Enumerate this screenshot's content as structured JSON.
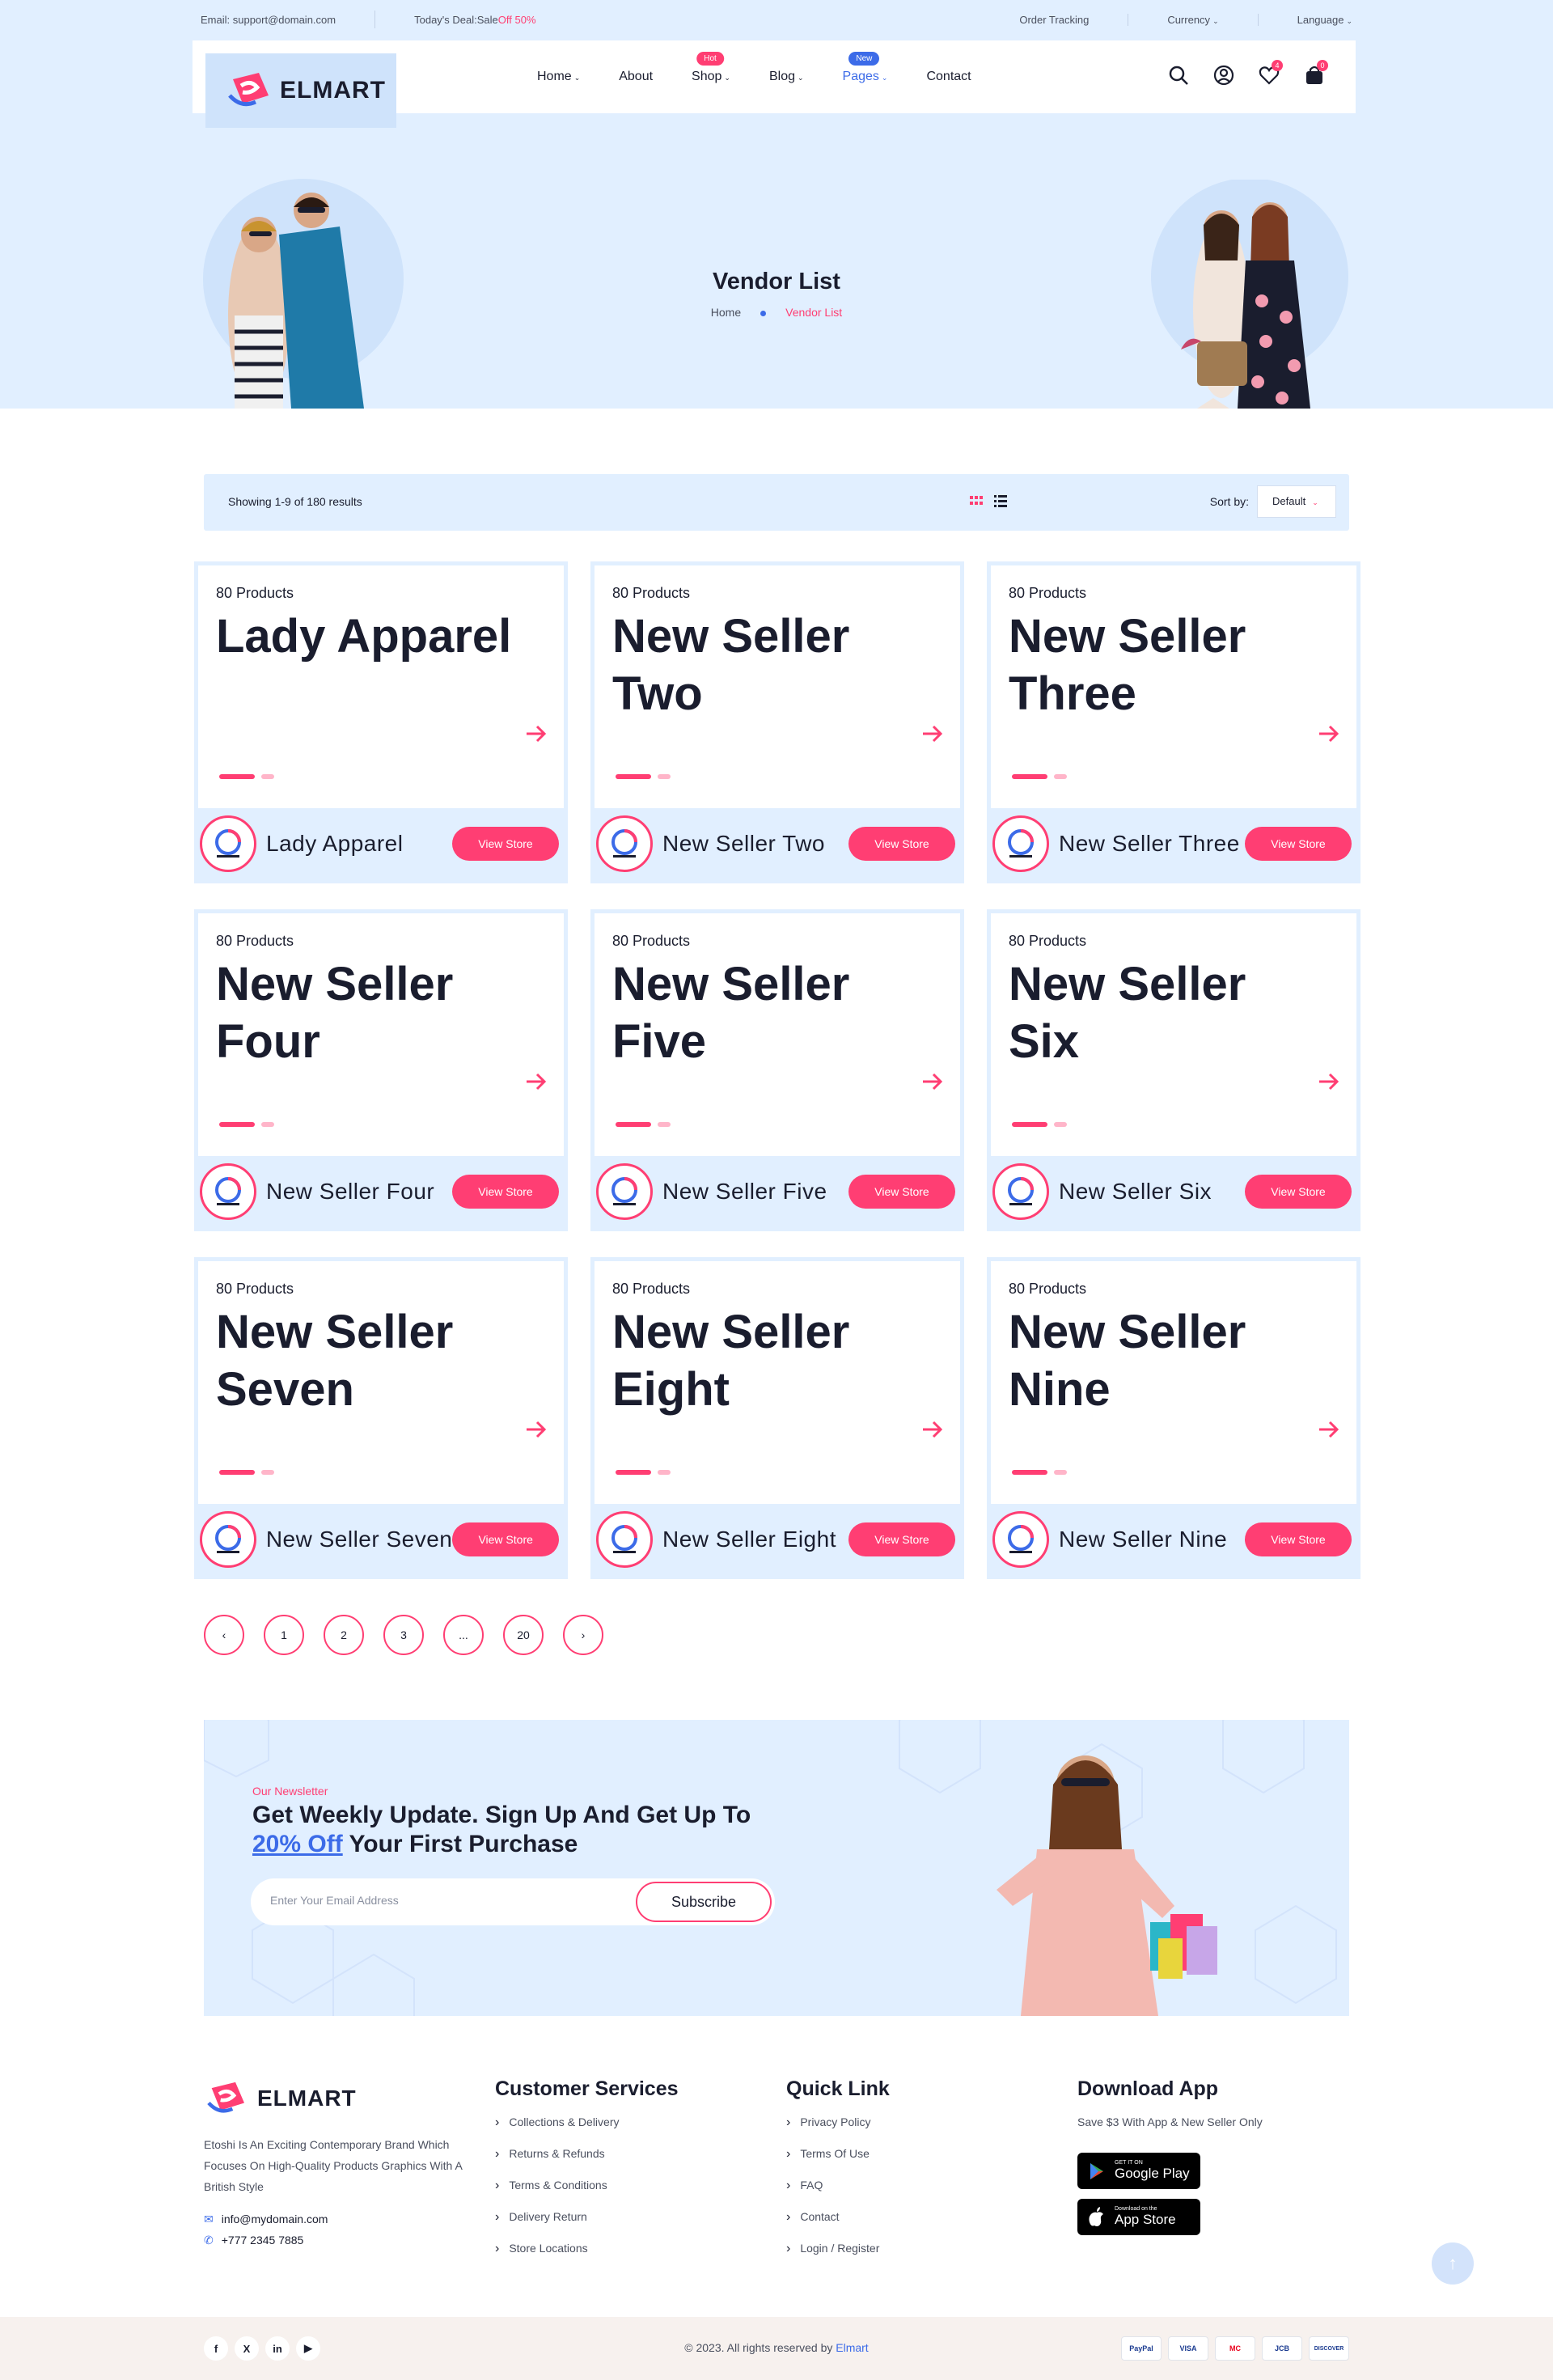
{
  "topbar": {
    "email": "Email: support@domain.com",
    "deal_label": "Today's Deal:Sale ",
    "deal_off": "Off 50%",
    "order_tracking": "Order Tracking",
    "currency": "Currency",
    "language": "Language"
  },
  "brand": {
    "name": "ELMART",
    "accent": "#ff3e73",
    "blue": "#3c6be8"
  },
  "nav": {
    "items": [
      {
        "label": "Home",
        "dropdown": true
      },
      {
        "label": "About",
        "dropdown": false
      },
      {
        "label": "Shop",
        "dropdown": true,
        "badge": "Hot"
      },
      {
        "label": "Blog",
        "dropdown": true
      },
      {
        "label": "Pages",
        "dropdown": true,
        "badge": "New",
        "active": true
      },
      {
        "label": "Contact",
        "dropdown": false
      }
    ],
    "icons": [
      "search-icon",
      "user-icon",
      "heart-icon",
      "bag-icon"
    ],
    "wishlist_count": "4",
    "cart_count": "0"
  },
  "hero": {
    "title": "Vendor List",
    "crumb_home": "Home",
    "crumb_current": "Vendor List"
  },
  "toolbar": {
    "showing": "Showing 1-9 of 180 results",
    "sort_label": "Sort by:",
    "sort_value": "Default"
  },
  "vendors": [
    {
      "count": "80 Products",
      "title": "Lady Apparel",
      "name": "Lady Apparel",
      "btn": "View Store",
      "logo": "D"
    },
    {
      "count": "80 Products",
      "title": "New Seller Two",
      "name": "New Seller Two",
      "btn": "View Store",
      "logo": "D"
    },
    {
      "count": "80 Products",
      "title": "New Seller Three",
      "name": "New Seller Three",
      "btn": "View Store",
      "logo": "D"
    },
    {
      "count": "80 Products",
      "title": "New Seller Four",
      "name": "New Seller Four",
      "btn": "View Store",
      "logo": "d"
    },
    {
      "count": "80 Products",
      "title": "New Seller Five",
      "name": "New Seller Five",
      "btn": "View Store",
      "logo": "d"
    },
    {
      "count": "80 Products",
      "title": "New Seller Six",
      "name": "New Seller Six",
      "btn": "View Store",
      "logo": "D"
    },
    {
      "count": "80 Products",
      "title": "New Seller Seven",
      "name": "New Seller Seven",
      "btn": "View Store",
      "logo": "D"
    },
    {
      "count": "80 Products",
      "title": "New Seller Eight",
      "name": "New Seller Eight",
      "btn": "View Store",
      "logo": "D"
    },
    {
      "count": "80 Products",
      "title": "New Seller Nine",
      "name": "New Seller Nine",
      "btn": "View Store",
      "logo": "D"
    }
  ],
  "pagination": {
    "pages": [
      "1",
      "2",
      "3",
      "...",
      "20"
    ]
  },
  "newsletter": {
    "eyebrow": "Our Newsletter",
    "heading_line1": "Get Weekly Update. Sign Up And Get Up To",
    "highlight": "20% Off",
    "heading_line2_rest": " Your First Purchase",
    "placeholder": "Enter Your Email Address",
    "button": "Subscribe"
  },
  "footer": {
    "about": "Etoshi Is An Exciting Contemporary Brand Which Focuses On High-Quality Products Graphics With A British Style",
    "email": "info@mydomain.com",
    "phone": "+777 2345 7885",
    "customer_services": {
      "title": "Customer Services",
      "links": [
        "Collections & Delivery",
        "Returns & Refunds",
        "Terms & Conditions",
        "Delivery Return",
        "Store Locations"
      ]
    },
    "quick_link": {
      "title": "Quick Link",
      "links": [
        "Privacy Policy",
        "Terms Of Use",
        "FAQ",
        "Contact",
        "Login / Register"
      ]
    },
    "download": {
      "title": "Download App",
      "subtitle": "Save $3 With App & New Seller Only",
      "google_small": "GET IT ON",
      "google_big": "Google Play",
      "apple_small": "Download on the",
      "apple_big": "App Store"
    },
    "copyright_prefix": "© 2023. All rights reserved by ",
    "copyright_brand": "Elmart",
    "socials": [
      "f",
      "X",
      "in",
      "▶"
    ],
    "payments": [
      "PayPal",
      "VISA",
      "MC",
      "JCB",
      "DISCOVER"
    ]
  }
}
